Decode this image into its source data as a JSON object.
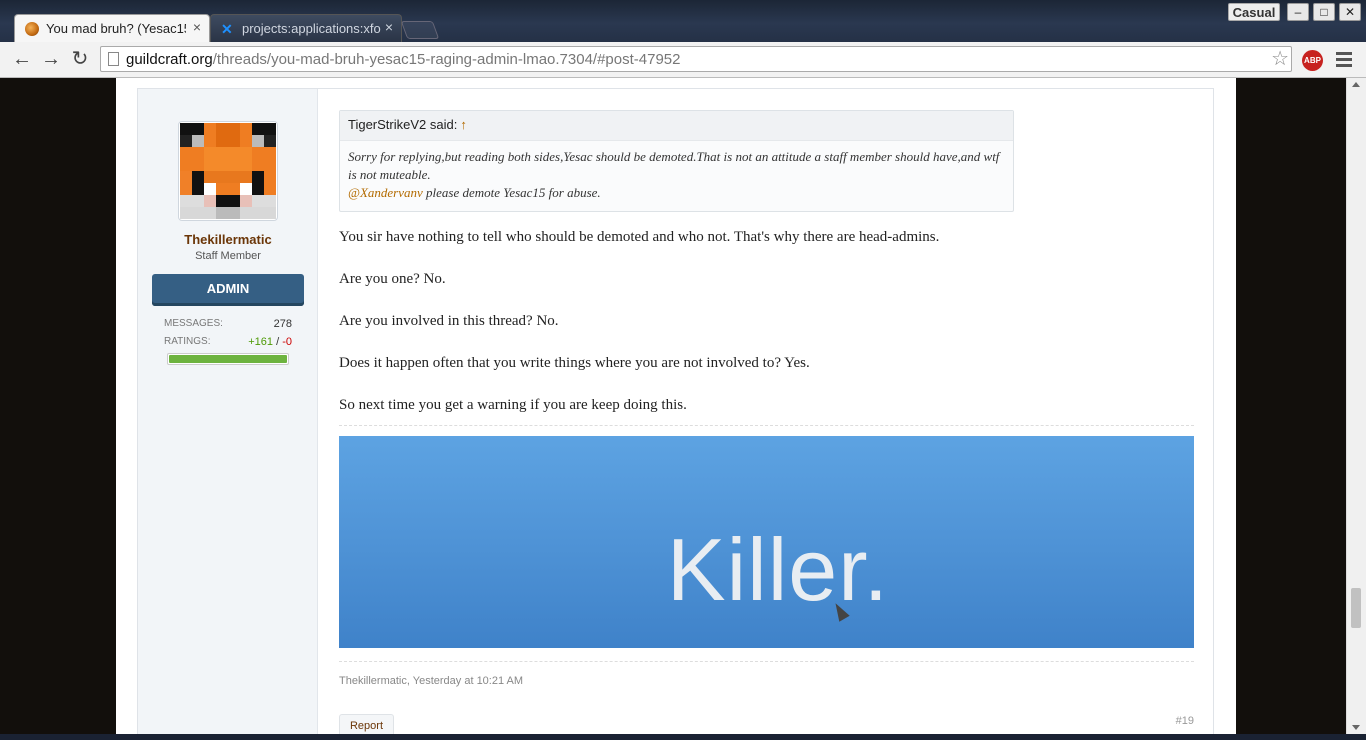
{
  "browser": {
    "profile": "Casual",
    "tabs": [
      {
        "title": "You mad bruh? (Yesac15",
        "active": true
      },
      {
        "title": "projects:applications:xfo",
        "active": false
      }
    ],
    "url_host": "guildcraft.org",
    "url_path": "/threads/you-mad-bruh-yesac15-raging-admin-lmao.7304/#post-47952",
    "abp_label": "ABP",
    "icons": {
      "back": "back-arrow-icon",
      "forward": "forward-arrow-icon",
      "reload": "reload-icon",
      "star": "bookmark-star-icon",
      "menu": "hamburger-menu-icon",
      "close": "close-icon",
      "minimize": "minimize-icon",
      "maximize": "maximize-icon"
    }
  },
  "post": {
    "user": {
      "name": "Thekillermatic",
      "title": "Staff Member",
      "banner": "ADMIN",
      "messages_label": "MESSAGES:",
      "messages": "278",
      "ratings_label": "RATINGS:",
      "ratings_pos": "+161",
      "ratings_sep": "/",
      "ratings_neg": "-0",
      "rating_fraction": 1.0
    },
    "quote": {
      "author_said": "TigerStrikeV2 said:",
      "arrow": "↑",
      "line1": "Sorry for replying,but reading both sides,Yesac should be demoted.That is not an attitude a staff member should have,and wtf is not muteable.",
      "mention": "@Xandervanv",
      "line2": " please demote Yesac15 for abuse."
    },
    "paragraphs": [
      "You sir have nothing to tell who should be demoted and who not. That's why there are head-admins.",
      "Are you one? No.",
      "Are you involved in this thread? No.",
      "Does it happen often that you write things where you are not involved to? Yes.",
      "So next time you get a warning if you are keep doing this."
    ],
    "signature_text": "Killer.",
    "meta": "Thekillermatic, Yesterday at 10:21 AM",
    "report": "Report",
    "number": "#19"
  },
  "colors": {
    "accent_brown": "#6b3608",
    "admin_banner": "#355f84",
    "rating_positive": "#4e9a06",
    "rating_negative": "#cc0000",
    "signature_blue": "#4f93d6"
  }
}
